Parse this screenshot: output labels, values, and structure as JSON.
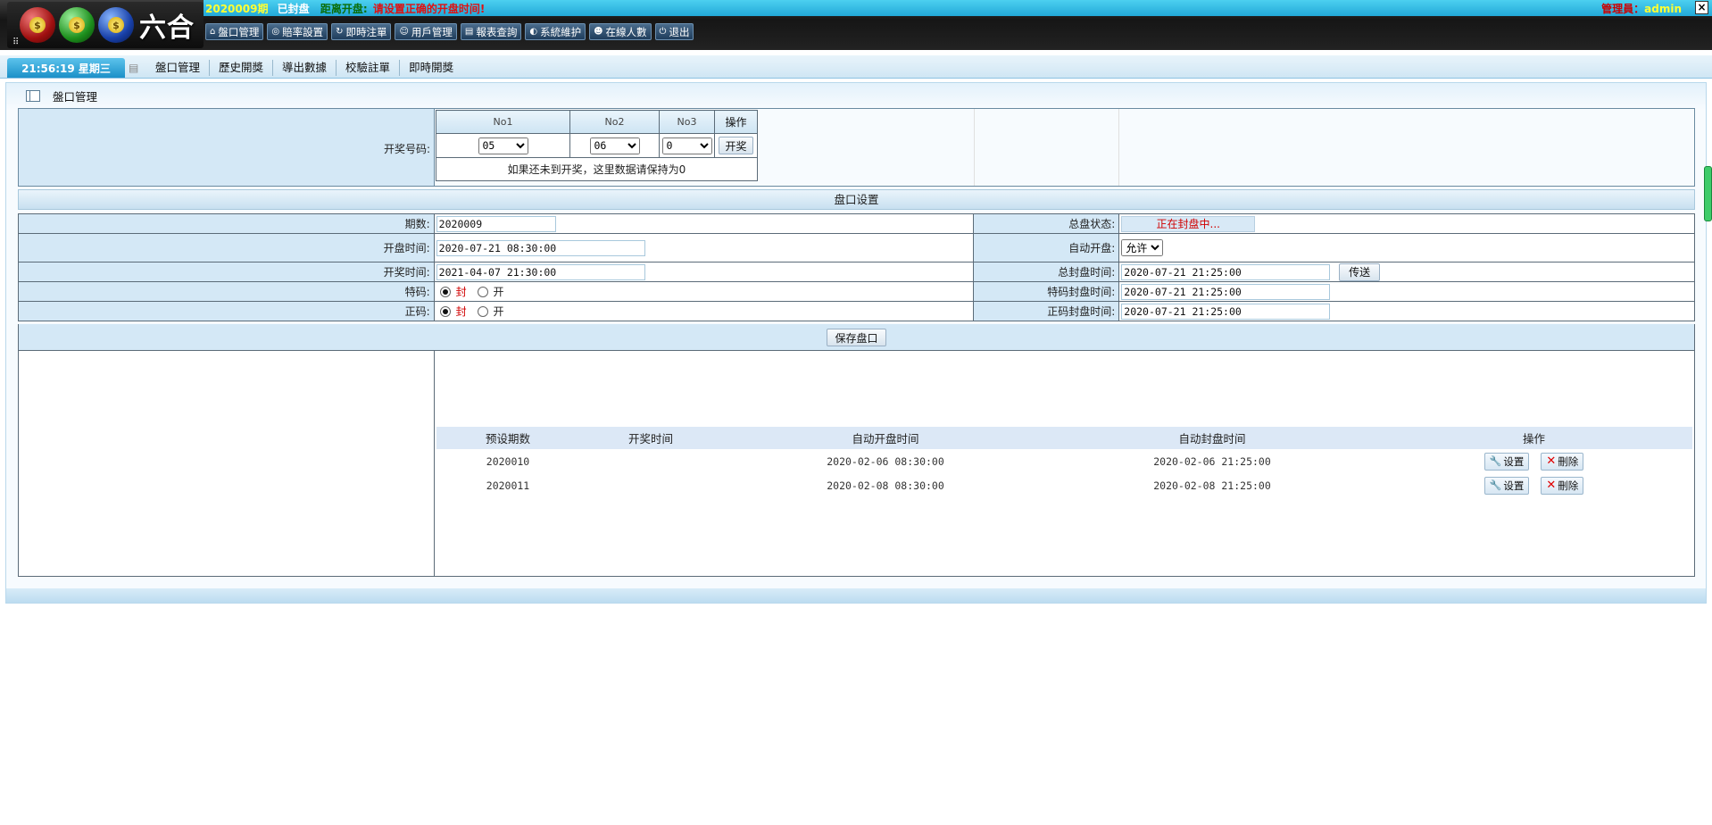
{
  "header": {
    "period": "2020009期",
    "status": "已封盘",
    "countdown_label": "距离开盘:",
    "countdown_msg": "请设置正确的开盘时间!",
    "admin_label": "管理員：",
    "admin_name": "admin",
    "close_glyph": "×",
    "logo_text": "六合",
    "logo_coin": "$",
    "nav": [
      {
        "label": "盤口管理",
        "icon": "home-icon",
        "glyph": "⌂"
      },
      {
        "label": "賠率設置",
        "icon": "target-icon",
        "glyph": "◎"
      },
      {
        "label": "即時注單",
        "icon": "refresh-icon",
        "glyph": "↻"
      },
      {
        "label": "用戶管理",
        "icon": "user-icon",
        "glyph": "☺"
      },
      {
        "label": "報表查詢",
        "icon": "report-icon",
        "glyph": "▤"
      },
      {
        "label": "系統維护",
        "icon": "speaker-icon",
        "glyph": "◐"
      },
      {
        "label": "在線人數",
        "icon": "online-icon",
        "glyph": "☻"
      },
      {
        "label": "退出",
        "icon": "power-icon",
        "glyph": "⏻"
      }
    ]
  },
  "tabbar": {
    "clock": "21:56:19 星期三",
    "tabs": [
      "盤口管理",
      "歷史開獎",
      "導出數據",
      "校驗註單",
      "即時開獎"
    ]
  },
  "panel": {
    "title": "盤口管理",
    "draw": {
      "label": "开奖号码:",
      "cols": [
        "No1",
        "No2",
        "No3",
        "操作"
      ],
      "values": [
        "05",
        "06",
        "0"
      ],
      "draw_button": "开奖",
      "hint": "如果还未到开奖，这里数据请保持为0"
    },
    "settings_title": "盘口设置",
    "form": {
      "period_label": "期数:",
      "period_value": "2020009",
      "total_status_label": "总盘状态:",
      "total_status_value": "正在封盘中...",
      "open_time_label": "开盘时间:",
      "open_time_value": "2020-07-21 08:30:00",
      "auto_open_label": "自动开盘:",
      "auto_open_value": "允许",
      "draw_time_label": "开奖时间:",
      "draw_time_value": "2021-04-07 21:30:00",
      "total_close_label": "总封盘时间:",
      "total_close_value": "2020-07-21 21:25:00",
      "send_button": "传送",
      "special_label": "特码:",
      "special_close_label": "特码封盘时间:",
      "special_close_value": "2020-07-21 21:25:00",
      "normal_label": "正码:",
      "normal_close_label": "正码封盘时间:",
      "normal_close_value": "2020-07-21 21:25:00",
      "radio_closed": "封",
      "radio_open": "开"
    },
    "save_button": "保存盘口",
    "presets": {
      "headers": [
        "预设期数",
        "开奖时间",
        "自动开盘时间",
        "自动封盘时间",
        "操作"
      ],
      "rows": [
        {
          "period": "2020010",
          "draw_time": "",
          "auto_open": "2020-02-06 08:30:00",
          "auto_close": "2020-02-06 21:25:00"
        },
        {
          "period": "2020011",
          "draw_time": "",
          "auto_open": "2020-02-08 08:30:00",
          "auto_close": "2020-02-08 21:25:00"
        }
      ],
      "edit_label": "设置",
      "delete_label": "刪除"
    }
  },
  "colors": {
    "header_bg": "#222222",
    "info_bar": "#3cc0e8",
    "period_text": "#ffff33",
    "alert_text": "#e01010",
    "admin_text": "#cc0000",
    "panel_cell": "#d4e8f6",
    "scroll_thumb": "#3ecc6a"
  }
}
